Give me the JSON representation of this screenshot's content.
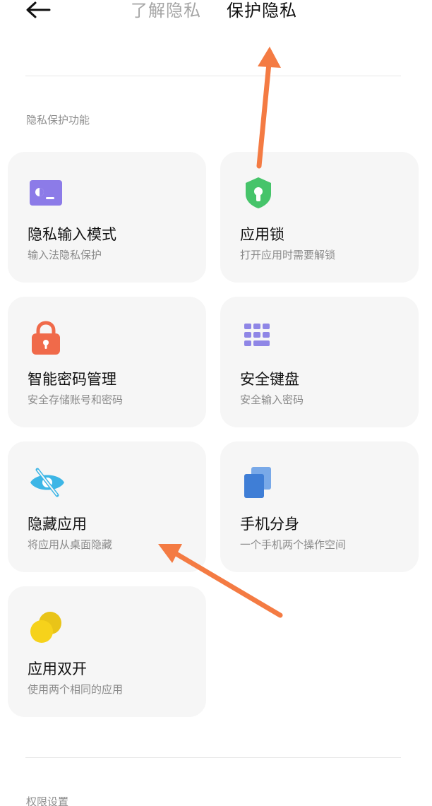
{
  "header": {
    "tabs": [
      {
        "label": "了解隐私"
      },
      {
        "label": "保护隐私"
      }
    ]
  },
  "sections": {
    "privacy_title": "隐私保护功能",
    "permissions_title": "权限设置"
  },
  "cards": [
    {
      "title": "隐私输入模式",
      "subtitle": "输入法隐私保护",
      "icon": "keyboard-privacy-icon"
    },
    {
      "title": "应用锁",
      "subtitle": "打开应用时需要解锁",
      "icon": "shield-keyhole-icon"
    },
    {
      "title": "智能密码管理",
      "subtitle": "安全存储账号和密码",
      "icon": "padlock-icon"
    },
    {
      "title": "安全键盘",
      "subtitle": "安全输入密码",
      "icon": "keypad-grid-icon"
    },
    {
      "title": "隐藏应用",
      "subtitle": "将应用从桌面隐藏",
      "icon": "eye-slash-icon"
    },
    {
      "title": "手机分身",
      "subtitle": "一个手机两个操作空间",
      "icon": "dual-pages-icon"
    },
    {
      "title": "应用双开",
      "subtitle": "使用两个相同的应用",
      "icon": "double-circle-icon"
    }
  ],
  "colors": {
    "annotation_arrow": "#f47b43",
    "card_background": "#f6f6f6",
    "active_tab": "#111111",
    "inactive_tab": "#a6a6a6"
  }
}
